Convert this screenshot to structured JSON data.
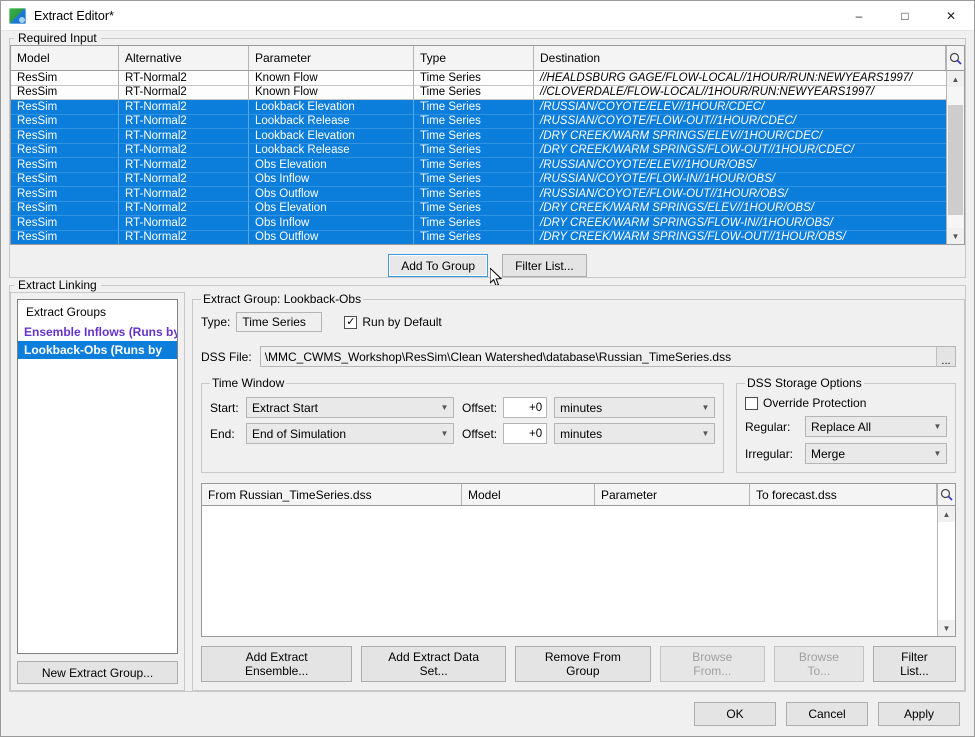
{
  "window": {
    "title": "Extract Editor*",
    "icon": "extract-editor-icon",
    "minimize": "–",
    "maximize": "□",
    "close": "✕"
  },
  "required_input": {
    "legend": "Required Input",
    "search_icon": "search-icon",
    "columns": [
      "Model",
      "Alternative",
      "Parameter",
      "Type",
      "Destination"
    ],
    "rows": [
      {
        "model": "ResSim",
        "alternative": "RT-Normal2",
        "parameter": "Known Flow",
        "type": "Time Series",
        "destination": "//HEALDSBURG GAGE/FLOW-LOCAL//1HOUR/RUN:NEWYEARS1997/",
        "selected": false
      },
      {
        "model": "ResSim",
        "alternative": "RT-Normal2",
        "parameter": "Known Flow",
        "type": "Time Series",
        "destination": "//CLOVERDALE/FLOW-LOCAL//1HOUR/RUN:NEWYEARS1997/",
        "selected": false
      },
      {
        "model": "ResSim",
        "alternative": "RT-Normal2",
        "parameter": "Lookback Elevation",
        "type": "Time Series",
        "destination": "/RUSSIAN/COYOTE/ELEV//1HOUR/CDEC/",
        "selected": true
      },
      {
        "model": "ResSim",
        "alternative": "RT-Normal2",
        "parameter": "Lookback Release",
        "type": "Time Series",
        "destination": "/RUSSIAN/COYOTE/FLOW-OUT//1HOUR/CDEC/",
        "selected": true
      },
      {
        "model": "ResSim",
        "alternative": "RT-Normal2",
        "parameter": "Lookback Elevation",
        "type": "Time Series",
        "destination": "/DRY CREEK/WARM SPRINGS/ELEV//1HOUR/CDEC/",
        "selected": true
      },
      {
        "model": "ResSim",
        "alternative": "RT-Normal2",
        "parameter": "Lookback Release",
        "type": "Time Series",
        "destination": "/DRY CREEK/WARM SPRINGS/FLOW-OUT//1HOUR/CDEC/",
        "selected": true
      },
      {
        "model": "ResSim",
        "alternative": "RT-Normal2",
        "parameter": "Obs Elevation",
        "type": "Time Series",
        "destination": "/RUSSIAN/COYOTE/ELEV//1HOUR/OBS/",
        "selected": true
      },
      {
        "model": "ResSim",
        "alternative": "RT-Normal2",
        "parameter": "Obs Inflow",
        "type": "Time Series",
        "destination": "/RUSSIAN/COYOTE/FLOW-IN//1HOUR/OBS/",
        "selected": true
      },
      {
        "model": "ResSim",
        "alternative": "RT-Normal2",
        "parameter": "Obs Outflow",
        "type": "Time Series",
        "destination": "/RUSSIAN/COYOTE/FLOW-OUT//1HOUR/OBS/",
        "selected": true
      },
      {
        "model": "ResSim",
        "alternative": "RT-Normal2",
        "parameter": "Obs Elevation",
        "type": "Time Series",
        "destination": "/DRY CREEK/WARM SPRINGS/ELEV//1HOUR/OBS/",
        "selected": true
      },
      {
        "model": "ResSim",
        "alternative": "RT-Normal2",
        "parameter": "Obs Inflow",
        "type": "Time Series",
        "destination": "/DRY CREEK/WARM SPRINGS/FLOW-IN//1HOUR/OBS/",
        "selected": true
      },
      {
        "model": "ResSim",
        "alternative": "RT-Normal2",
        "parameter": "Obs Outflow",
        "type": "Time Series",
        "destination": "/DRY CREEK/WARM SPRINGS/FLOW-OUT//1HOUR/OBS/",
        "selected": true
      }
    ],
    "buttons": {
      "add_to_group": "Add To Group",
      "filter_list": "Filter List..."
    }
  },
  "extract_linking": {
    "legend": "Extract Linking",
    "groups": {
      "header": "Extract Groups",
      "items": [
        {
          "label": "Ensemble Inflows (Runs by D...",
          "selected": false
        },
        {
          "label": "Lookback-Obs (Runs by",
          "selected": true
        }
      ],
      "new_group_button": "New Extract Group..."
    },
    "detail": {
      "legend": "Extract Group: Lookback-Obs",
      "type_label": "Type:",
      "type_value": "Time Series",
      "run_by_default_label": "Run by Default",
      "run_by_default_checked": "✓",
      "dss_file_label": "DSS File:",
      "dss_file_value": "\\MMC_CWMS_Workshop\\ResSim\\Clean Watershed\\database\\Russian_TimeSeries.dss",
      "browse_ellipsis": "...",
      "time_window": {
        "legend": "Time Window",
        "start_label": "Start:",
        "start_value": "Extract Start",
        "start_offset": "+0",
        "start_units": "minutes",
        "end_label": "End:",
        "end_value": "End of Simulation",
        "end_offset": "+0",
        "end_units": "minutes",
        "offset_label": "Offset:"
      },
      "dss_storage": {
        "legend": "DSS Storage Options",
        "override_protection_label": "Override Protection",
        "override_protection_checked": false,
        "regular_label": "Regular:",
        "regular_value": "Replace All",
        "irregular_label": "Irregular:",
        "irregular_value": "Merge"
      },
      "link_table": {
        "columns": [
          "From Russian_TimeSeries.dss",
          "Model",
          "Parameter",
          "To forecast.dss"
        ],
        "rows": [],
        "search_icon": "search-icon"
      },
      "buttons": [
        {
          "label": "Add Extract Ensemble...",
          "disabled": false,
          "name": "add-extract-ensemble-button"
        },
        {
          "label": "Add Extract Data Set...",
          "disabled": false,
          "name": "add-extract-data-set-button"
        },
        {
          "label": "Remove From Group",
          "disabled": false,
          "name": "remove-from-group-button"
        },
        {
          "label": "Browse From...",
          "disabled": true,
          "name": "browse-from-button"
        },
        {
          "label": "Browse To...",
          "disabled": true,
          "name": "browse-to-button"
        },
        {
          "label": "Filter List...",
          "disabled": false,
          "name": "filter-list-button-lower"
        }
      ]
    }
  },
  "footer": {
    "ok": "OK",
    "cancel": "Cancel",
    "apply": "Apply"
  },
  "colors": {
    "selection_blue": "#0b7ddb",
    "link_purple": "#6633cc",
    "window_bg": "#f0f0f0"
  }
}
